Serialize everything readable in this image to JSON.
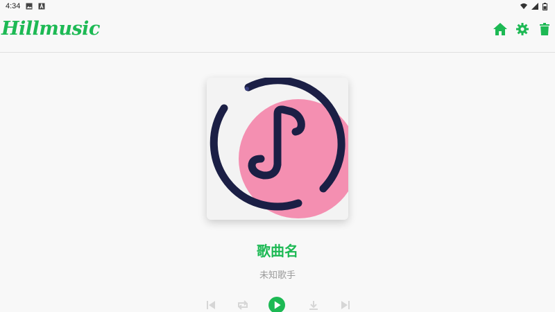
{
  "status_bar": {
    "time": "4:34",
    "icons": [
      "gallery-icon",
      "a-icon",
      "wifi-icon",
      "signal-icon",
      "battery-icon"
    ]
  },
  "app": {
    "logo_text": "Hillmusic",
    "accent_color": "#1db954",
    "actions": [
      "home-icon",
      "settings-icon",
      "delete-icon"
    ]
  },
  "player": {
    "title": "歌曲名",
    "artist": "未知歌手",
    "controls": [
      "previous-icon",
      "repeat-icon",
      "play-icon",
      "download-icon",
      "next-icon"
    ]
  },
  "cover": {
    "ring_color": "#1b1f45",
    "circle_color": "#f48fb1"
  }
}
